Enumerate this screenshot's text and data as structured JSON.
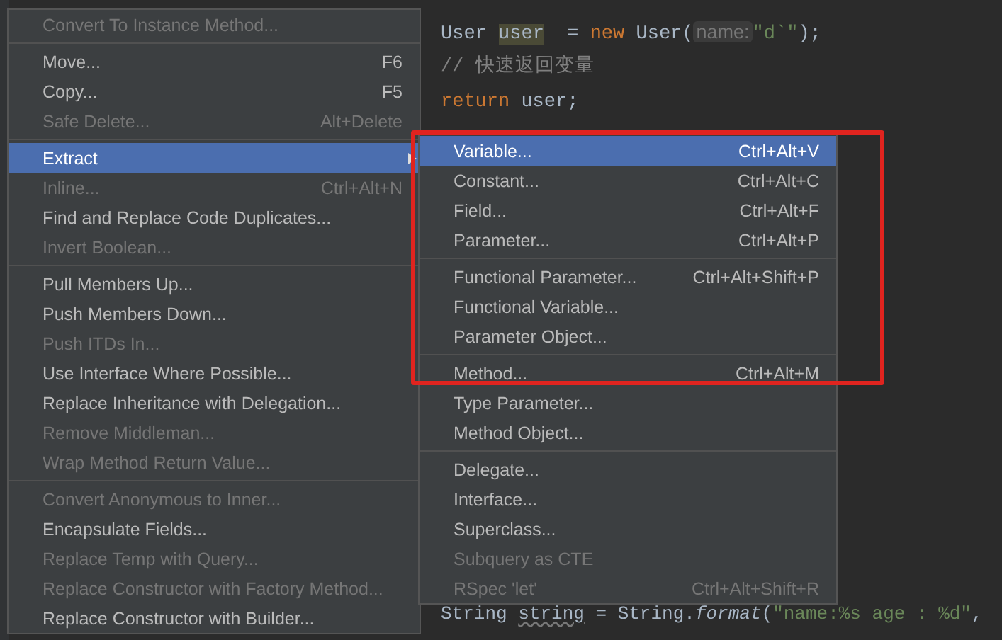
{
  "editor": {
    "lines": [
      {
        "tokens": [
          {
            "kind": "plain",
            "text": "User "
          },
          {
            "kind": "highlight",
            "text": "user"
          },
          {
            "kind": "plain",
            "text": "  = "
          },
          {
            "kind": "keyword",
            "text": "new"
          },
          {
            "kind": "plain",
            "text": " User("
          },
          {
            "kind": "hint",
            "text": "name:"
          },
          {
            "kind": "string",
            "text": "\"d`\""
          },
          {
            "kind": "plain",
            "text": ");"
          }
        ]
      },
      {
        "tokens": [
          {
            "kind": "comment",
            "text": "// 快速返回变量"
          }
        ]
      },
      {
        "tokens": [
          {
            "kind": "keyword",
            "text": "return"
          },
          {
            "kind": "plain",
            "text": " user;"
          }
        ]
      },
      {
        "tokens": [
          {
            "kind": "plain",
            "text": "String "
          },
          {
            "kind": "warn",
            "text": "string"
          },
          {
            "kind": "plain",
            "text": " = String."
          },
          {
            "kind": "italic",
            "text": "format"
          },
          {
            "kind": "plain",
            "text": "("
          },
          {
            "kind": "string",
            "text": "\"name:%s age : %d\""
          },
          {
            "kind": "plain",
            "text": ","
          }
        ]
      }
    ]
  },
  "menu": {
    "groups": [
      [
        {
          "label": "Convert To Instance Method...",
          "disabled": true,
          "selected": false
        }
      ],
      [
        {
          "label": "Move...",
          "shortcut": "F6",
          "disabled": false,
          "selected": false
        },
        {
          "label": "Copy...",
          "shortcut": "F5",
          "disabled": false,
          "selected": false
        },
        {
          "label": "Safe Delete...",
          "shortcut": "Alt+Delete",
          "disabled": true,
          "selected": false
        }
      ],
      [
        {
          "label": "Extract",
          "disabled": false,
          "selected": true,
          "submenu": true
        },
        {
          "label": "Inline...",
          "shortcut": "Ctrl+Alt+N",
          "disabled": true,
          "selected": false
        },
        {
          "label": "Find and Replace Code Duplicates...",
          "disabled": false,
          "selected": false
        },
        {
          "label": "Invert Boolean...",
          "disabled": true,
          "selected": false
        }
      ],
      [
        {
          "label": "Pull Members Up...",
          "disabled": false,
          "selected": false
        },
        {
          "label": "Push Members Down...",
          "disabled": false,
          "selected": false
        },
        {
          "label": "Push ITDs In...",
          "disabled": true,
          "selected": false
        },
        {
          "label": "Use Interface Where Possible...",
          "disabled": false,
          "selected": false
        },
        {
          "label": "Replace Inheritance with Delegation...",
          "disabled": false,
          "selected": false
        },
        {
          "label": "Remove Middleman...",
          "disabled": true,
          "selected": false
        },
        {
          "label": "Wrap Method Return Value...",
          "disabled": true,
          "selected": false
        }
      ],
      [
        {
          "label": "Convert Anonymous to Inner...",
          "disabled": true,
          "selected": false
        },
        {
          "label": "Encapsulate Fields...",
          "disabled": false,
          "selected": false
        },
        {
          "label": "Replace Temp with Query...",
          "disabled": true,
          "selected": false
        },
        {
          "label": "Replace Constructor with Factory Method...",
          "disabled": true,
          "selected": false
        },
        {
          "label": "Replace Constructor with Builder...",
          "disabled": false,
          "selected": false
        }
      ]
    ]
  },
  "submenu": {
    "groups": [
      [
        {
          "label": "Variable...",
          "shortcut": "Ctrl+Alt+V",
          "disabled": false,
          "selected": true
        },
        {
          "label": "Constant...",
          "shortcut": "Ctrl+Alt+C",
          "disabled": false,
          "selected": false
        },
        {
          "label": "Field...",
          "shortcut": "Ctrl+Alt+F",
          "disabled": false,
          "selected": false
        },
        {
          "label": "Parameter...",
          "shortcut": "Ctrl+Alt+P",
          "disabled": false,
          "selected": false
        }
      ],
      [
        {
          "label": "Functional Parameter...",
          "shortcut": "Ctrl+Alt+Shift+P",
          "disabled": false,
          "selected": false
        },
        {
          "label": "Functional Variable...",
          "disabled": false,
          "selected": false
        },
        {
          "label": "Parameter Object...",
          "disabled": false,
          "selected": false
        }
      ],
      [
        {
          "label": "Method...",
          "shortcut": "Ctrl+Alt+M",
          "disabled": false,
          "selected": false
        },
        {
          "label": "Type Parameter...",
          "disabled": false,
          "selected": false
        },
        {
          "label": "Method Object...",
          "disabled": false,
          "selected": false
        }
      ],
      [
        {
          "label": "Delegate...",
          "disabled": false,
          "selected": false
        },
        {
          "label": "Interface...",
          "disabled": false,
          "selected": false
        },
        {
          "label": "Superclass...",
          "disabled": false,
          "selected": false
        },
        {
          "label": "Subquery as CTE",
          "disabled": true,
          "selected": false
        },
        {
          "label": "RSpec 'let'",
          "shortcut": "Ctrl+Alt+Shift+R",
          "disabled": true,
          "selected": false
        }
      ]
    ]
  }
}
